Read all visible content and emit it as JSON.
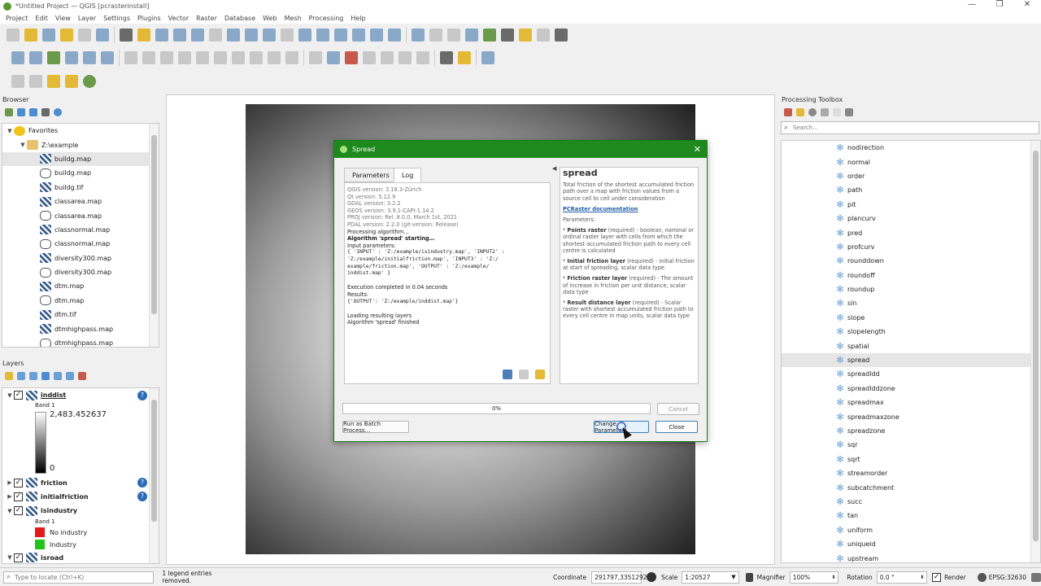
{
  "window": {
    "title": "*Untitled Project — QGIS [pcrasterinstall]",
    "min": "—",
    "max": "❐",
    "close": "✕"
  },
  "menu": [
    "Project",
    "Edit",
    "View",
    "Layer",
    "Settings",
    "Plugins",
    "Vector",
    "Raster",
    "Database",
    "Web",
    "Mesh",
    "Processing",
    "Help"
  ],
  "browser": {
    "title": "Browser",
    "items": [
      {
        "label": "Favorites",
        "type": "star",
        "indent": 0,
        "tw": "▼"
      },
      {
        "label": "Z:\\example",
        "type": "folder",
        "indent": 1,
        "tw": "▼"
      },
      {
        "label": "buildg.map",
        "type": "grid",
        "indent": 2,
        "tw": ""
      },
      {
        "label": "buildg.map",
        "type": "vec",
        "indent": 2,
        "tw": ""
      },
      {
        "label": "buildg.tif",
        "type": "grid",
        "indent": 2,
        "tw": ""
      },
      {
        "label": "classarea.map",
        "type": "grid",
        "indent": 2,
        "tw": ""
      },
      {
        "label": "classarea.map",
        "type": "vec",
        "indent": 2,
        "tw": ""
      },
      {
        "label": "classnormal.map",
        "type": "grid",
        "indent": 2,
        "tw": ""
      },
      {
        "label": "classnormal.map",
        "type": "vec",
        "indent": 2,
        "tw": ""
      },
      {
        "label": "diversity300.map",
        "type": "grid",
        "indent": 2,
        "tw": ""
      },
      {
        "label": "diversity300.map",
        "type": "vec",
        "indent": 2,
        "tw": ""
      },
      {
        "label": "dtm.map",
        "type": "grid",
        "indent": 2,
        "tw": ""
      },
      {
        "label": "dtm.map",
        "type": "vec",
        "indent": 2,
        "tw": ""
      },
      {
        "label": "dtm.tif",
        "type": "grid",
        "indent": 2,
        "tw": ""
      },
      {
        "label": "dtmhighpass.map",
        "type": "grid",
        "indent": 2,
        "tw": ""
      },
      {
        "label": "dtmhighpass.map",
        "type": "vec",
        "indent": 2,
        "tw": ""
      }
    ]
  },
  "layers": {
    "title": "Layers",
    "inddist": {
      "name": "inddist",
      "band": "Band 1",
      "max": "2,483.452637",
      "min": "0"
    },
    "friction": "friction",
    "initialfriction": "initialfriction",
    "isindustry": {
      "name": "isindustry",
      "band": "Band 1",
      "classes": [
        {
          "label": "No industry",
          "color": "#e31a1c"
        },
        {
          "label": "Industry",
          "color": "#22c41a"
        }
      ]
    },
    "isroad": "isroad"
  },
  "dialog": {
    "title": "Spread",
    "tabs": [
      "Parameters",
      "Log"
    ],
    "log_lines": [
      {
        "t": "QGIS version: 3.18.3-Zürich",
        "c": "gray"
      },
      {
        "t": "Qt version: 5.12.9",
        "c": "gray"
      },
      {
        "t": "GDAL version: 3.2.2",
        "c": "gray"
      },
      {
        "t": "GEOS version: 3.9.1-CAPI-1.14.2",
        "c": "gray"
      },
      {
        "t": "PROJ version: Rel. 8.0.0, March 1st, 2021",
        "c": "gray"
      },
      {
        "t": "PDAL version: 2.2.0 (git-version: Release)",
        "c": "gray"
      },
      {
        "t": "Processing algorithm…",
        "c": ""
      },
      {
        "t": "Algorithm 'spread' starting…",
        "c": "bold"
      },
      {
        "t": "Input parameters:",
        "c": ""
      },
      {
        "t": "{ 'INPUT' : 'Z:/example/isindustry.map', 'INPUT2' :",
        "c": "mono"
      },
      {
        "t": "'Z:/example/initialfriction.map', 'INPUT3' : 'Z:/",
        "c": "mono"
      },
      {
        "t": "example/friction.map', 'OUTPUT' : 'Z:/example/",
        "c": "mono"
      },
      {
        "t": "inddist.map' }",
        "c": "mono"
      },
      {
        "t": " ",
        "c": ""
      },
      {
        "t": "Execution completed in 0.04 seconds",
        "c": ""
      },
      {
        "t": "Results:",
        "c": ""
      },
      {
        "t": "{'OUTPUT': 'Z:/example/inddist.map'}",
        "c": "mono"
      },
      {
        "t": " ",
        "c": ""
      },
      {
        "t": "Loading resulting layers",
        "c": ""
      },
      {
        "t": "Algorithm 'spread' finished",
        "c": ""
      }
    ],
    "help": {
      "heading": "spread",
      "desc": "Total friction of the shortest accumulated friction path over a map with friction values from a source cell to cell under consideration",
      "link": "PCRaster documentation",
      "params_label": "Parameters:",
      "params": [
        {
          "name": "Points raster",
          "text": " (required) - boolean, nominal or ordinal raster layer with cells from which the shortest accumulated friction path to every cell centre is calculated"
        },
        {
          "name": "Initial friction layer",
          "text": " (required) - initial friction at start of spreading, scalar data type"
        },
        {
          "name": "Friction raster layer",
          "text": " (required) - The amount of increase in friction per unit distance, scalar data type"
        },
        {
          "name": "Result distance layer",
          "text": " (required) - Scalar raster with shortest accumulated friction path to every cell centre in map units, scalar data type"
        }
      ]
    },
    "progress": "0%",
    "cancel": "Cancel",
    "batch": "Run as Batch Process…",
    "change": "Change Parameters",
    "close": "Close"
  },
  "toolbox": {
    "title": "Processing Toolbox",
    "search_placeholder": "Search...",
    "items": [
      "nodirection",
      "normal",
      "order",
      "path",
      "pit",
      "plancurv",
      "pred",
      "profcurv",
      "rounddown",
      "roundoff",
      "roundup",
      "sin",
      "slope",
      "slopelength",
      "spatial",
      "spread",
      "spreadldd",
      "spreadlddzone",
      "spreadmax",
      "spreadmaxzone",
      "spreadzone",
      "sqr",
      "sqrt",
      "streamorder",
      "subcatchment",
      "succ",
      "tan",
      "uniform",
      "uniqueid",
      "upstream"
    ],
    "selected": "spread"
  },
  "status": {
    "locate_placeholder": "Type to locate (Ctrl+K)",
    "message": "1 legend entries removed.",
    "coordinate_label": "Coordinate",
    "coordinate": "291797,3351292",
    "scale_label": "Scale",
    "scale": "1:20527",
    "magnifier_label": "Magnifier",
    "magnifier": "100%",
    "rotation_label": "Rotation",
    "rotation": "0.0 °",
    "render_label": "Render",
    "crs": "EPSG:32630"
  }
}
